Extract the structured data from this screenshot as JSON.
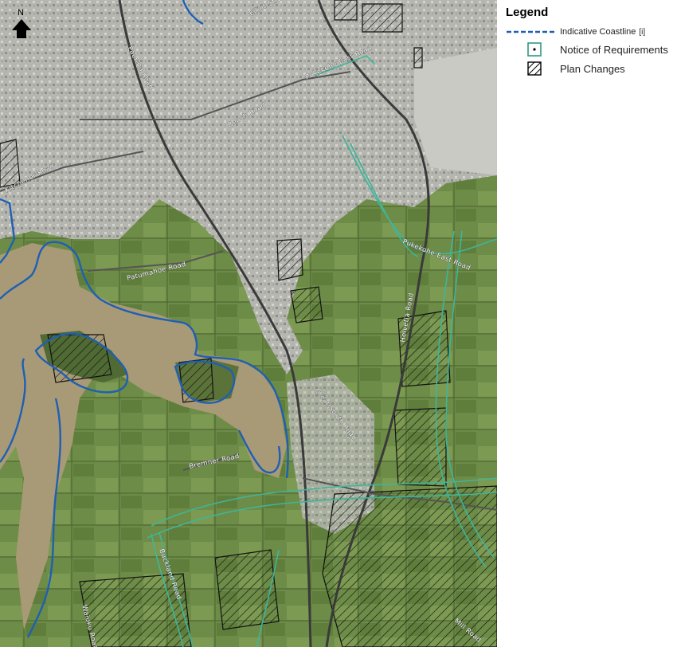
{
  "map": {
    "road_labels": [
      "Elliot Street",
      "Pukekohe East Road",
      "Paerata Road",
      "Beach Road",
      "Kitchener Road",
      "Pukekohe East Road",
      "Patumahoe Road",
      "Helvetia Road",
      "Great South Road",
      "Bremner Road",
      "Buckland Road",
      "Waiuku Road",
      "Mill Road"
    ],
    "north_arrow": {
      "letter": "N",
      "icon": "north-arrow-icon"
    }
  },
  "legend": {
    "title": "Legend",
    "items": [
      {
        "label": "Indicative Coastline",
        "info": "[i]",
        "symbol": "dashed-line",
        "color": "#1f5fb4"
      },
      {
        "label": "Notice of Requirements",
        "symbol": "teal-square-dot",
        "color": "#2e9a7e"
      },
      {
        "label": "Plan Changes",
        "symbol": "hatched-square",
        "color": "#000000"
      }
    ]
  },
  "colors": {
    "coastline": "#1f5fb4",
    "notice_of_requirements": "#3fb59a",
    "plan_changes": "#111111",
    "urban": "#b9bab4",
    "farmland": "#6f8f48",
    "estuary": "#a89a76"
  }
}
